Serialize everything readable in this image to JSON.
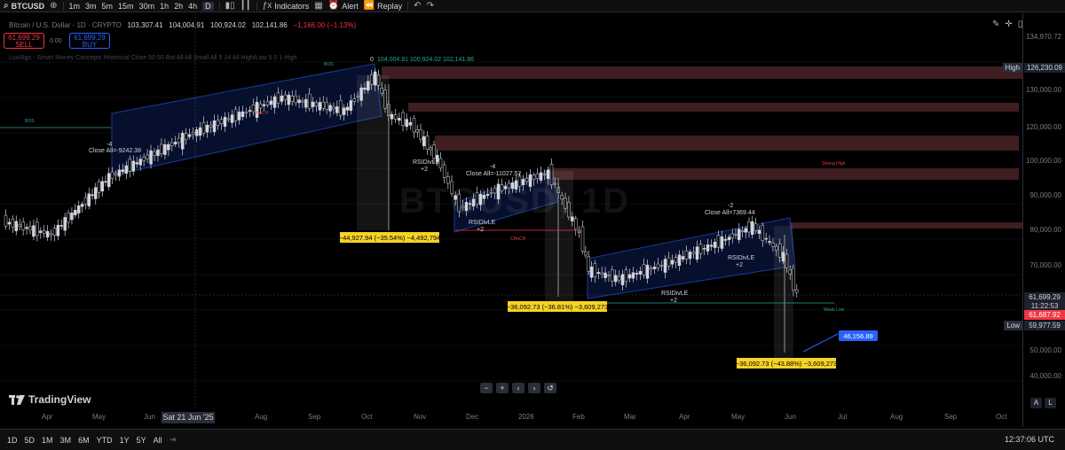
{
  "topbar": {
    "symbol": "BTCUSD",
    "intervals": [
      "1m",
      "3m",
      "5m",
      "15m",
      "30m",
      "1h",
      "2h",
      "4h",
      "D"
    ],
    "active_interval": "D",
    "indicators_label": "Indicators",
    "alert_label": "Alert",
    "replay_label": "Replay"
  },
  "legend": {
    "pair": "Bitcoin / U.S. Dollar · 1D · CRYPTO",
    "open": "103,307.41",
    "high": "104,004.91",
    "low": "100,924.02",
    "close": "102,141.86",
    "change": "−1,166.00 (−1.13%)"
  },
  "trade": {
    "sell_price": "61,699.29",
    "sell_label": "SELL",
    "buy_price": "61,699.29",
    "buy_label": "BUY",
    "spread": "0.00"
  },
  "indicator_text": "LuxAlgo - Smart Money Concepts Historical Close 50 50 Bot All All Small All 5 14 All High/Low 5 0 1 High",
  "chart_annotations": {
    "ohlc_top": "104,004.91  100,924.02  102,141.86",
    "ohlc_top_prefix": "0",
    "close_all_1": "Close All=-9242.38",
    "close_all_1_qty": "-4",
    "close_all_2": "Close All=-11027.52",
    "close_all_2_qty": "-4",
    "close_all_3": "Close All=7369.44",
    "close_all_3_qty": "-2",
    "rsi_1": "RSIDivLE",
    "rsi_1_qty": "+2",
    "rsi_2": "RSIDivLE",
    "rsi_2_qty": "+2",
    "rsi_3": "RSIDivLE",
    "rsi_3_qty": "+2",
    "rsi_4": "RSIDivLE",
    "rsi_4_qty": "+2",
    "measure_1": "−44,927.94 (−35.54%) −4,492,794",
    "measure_2": "−36,092.73 (−36.81%) −3,609,273",
    "measure_3": "−36,092.73 (−43.88%) −3,609,273",
    "target_price": "46,156.89",
    "strong_high": "Strong High",
    "weak_low": "Weak Low",
    "bos": "BOS",
    "choch": "CHoCH",
    "watermark": "BTCUSD, 1D"
  },
  "price_axis": {
    "labels": [
      {
        "v": "134,970.72"
      },
      {
        "v": "130,000.00"
      },
      {
        "v": "120,000.00"
      },
      {
        "v": "110,000.00"
      },
      {
        "v": "100,000.00"
      },
      {
        "v": "90,000.00"
      },
      {
        "v": "80,000.00"
      },
      {
        "v": "70,000.00"
      },
      {
        "v": "50,000.00"
      },
      {
        "v": "40,000.00"
      }
    ],
    "high_tag_label": "High",
    "high_tag_value": "126,230.09",
    "current_price": "61,699.29",
    "countdown": "11:22:53",
    "red_price": "61,687.92",
    "low_tag_label": "Low",
    "low_tag_value": "59,977.59"
  },
  "time_axis": {
    "labels": [
      "Apr",
      "May",
      "Jun",
      "Aug",
      "Sep",
      "Oct",
      "Nov",
      "Dec",
      "2026",
      "Feb",
      "Mar",
      "Apr",
      "May",
      "Jun",
      "Jul",
      "Aug",
      "Sep",
      "Oct"
    ],
    "crosshair_date": "Sat 21 Jun '25"
  },
  "bottom_bar": {
    "ranges": [
      "1D",
      "5D",
      "1M",
      "3M",
      "6M",
      "YTD",
      "1Y",
      "5Y",
      "All"
    ],
    "clock": "12:37:06 UTC"
  },
  "branding": {
    "logo_text": "TradingView"
  },
  "axis_buttons": {
    "auto": "A",
    "log": "L"
  },
  "colors": {
    "bull": "#d1d4dc",
    "bear": "#000000",
    "channel": "#2962ff",
    "sell": "#f23645",
    "buy": "#2962ff",
    "measure_bg": "#f5d327",
    "supply_zone": "#4a2226"
  }
}
